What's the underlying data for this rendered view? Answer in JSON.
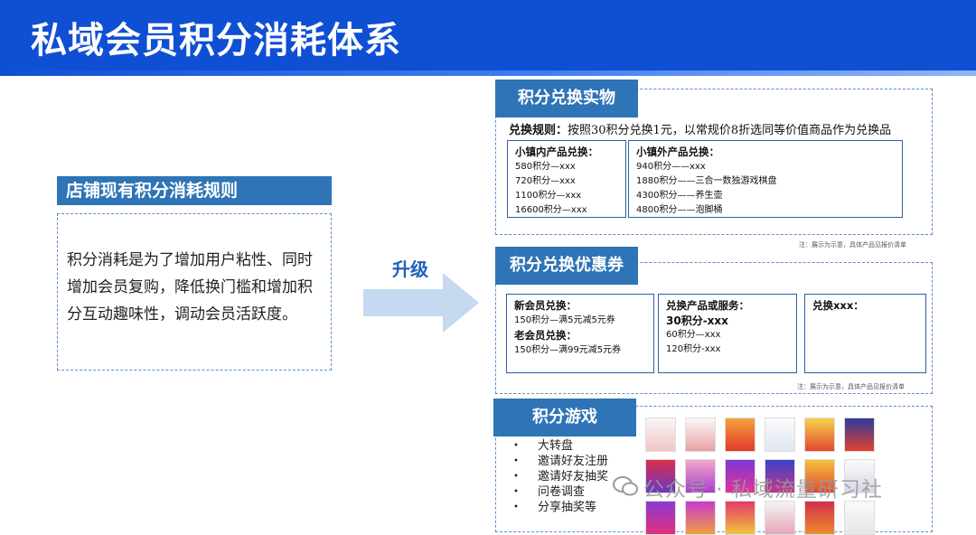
{
  "title": "私域会员积分消耗体系",
  "left": {
    "heading": "店铺现有积分消耗规则",
    "body": "积分消耗是为了增加用户粘性、同时增加会员复购，降低换门槛和增加积分互动趣味性，调动会员活跃度。"
  },
  "upgrade_label": "升级",
  "colors": {
    "header_blue": "#0f4fd4",
    "section_blue": "#2e74b6",
    "border_blue": "#2e5fa6"
  },
  "physical": {
    "heading": "积分兑换实物",
    "rule_label": "兑换规则：",
    "rule_text": "按照30积分兑换1元，以常规价8折选同等价值商品作为兑换品",
    "inner": {
      "title": "小镇内产品兑换：",
      "items": [
        "580积分—xxx",
        "720积分—xxx",
        "1100积分—xxx",
        "16600积分—xxx"
      ]
    },
    "outer": {
      "title": "小镇外产品兑换：",
      "items": [
        "940积分——xxx",
        "1880积分——三合一数独游戏棋盘",
        "4300积分——养生壶",
        "4800积分——泡脚桶"
      ]
    },
    "note": "注：展示为示意，具体产品见报价清单"
  },
  "coupon": {
    "heading": "积分兑换优惠券",
    "new_title": "新会员兑换：",
    "new_item": "150积分—满5元减5元券",
    "old_title": "老会员兑换：",
    "old_item": "150积分—满99元减5元券",
    "service_title": "兑换产品或服务：",
    "service_main": "30积分-xxx",
    "service_items": [
      "60积分—xxx",
      "120积分-xxx"
    ],
    "xxx_title": "兑换xxx：",
    "note": "注：展示为示意，具体产品见报价清单"
  },
  "games": {
    "heading": "积分游戏",
    "items": [
      "大转盘",
      "邀请好友注册",
      "邀请好友抽奖",
      "问卷调查",
      "分享抽奖等"
    ]
  },
  "watermark": "公众号 · 私域流量研习社"
}
